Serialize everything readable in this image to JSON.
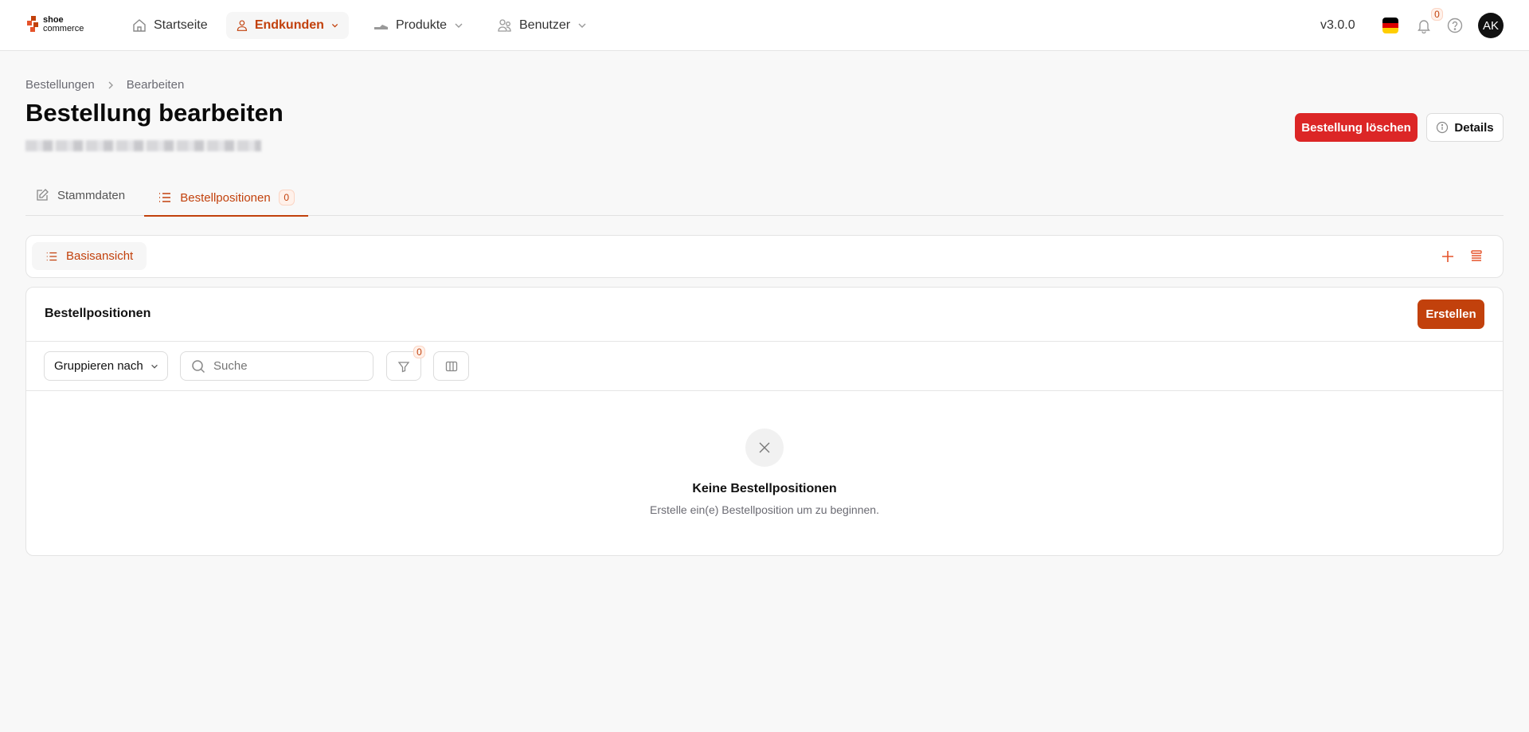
{
  "brand": {
    "line1": "shoe",
    "line2": "commerce",
    "color": "#c2410c"
  },
  "nav": [
    {
      "label": "Startseite",
      "icon": "home-icon"
    },
    {
      "label": "Endkunden",
      "icon": "user-icon",
      "active": true
    },
    {
      "label": "Produkte",
      "icon": "shoe-icon"
    },
    {
      "label": "Benutzer",
      "icon": "users-icon"
    }
  ],
  "header": {
    "version": "v3.0.0",
    "notifications": "0",
    "avatar": "AK",
    "language_flag": "de-flag-icon"
  },
  "breadcrumb": [
    "Bestellungen",
    "Bearbeiten"
  ],
  "page": {
    "title": "Bestellung bearbeiten",
    "delete_label": "Bestellung löschen",
    "details_label": "Details"
  },
  "tabs": [
    {
      "label": "Stammdaten"
    },
    {
      "label": "Bestellpositionen",
      "count": "0",
      "active": true
    }
  ],
  "views": {
    "active": "Basisansicht"
  },
  "list": {
    "title": "Bestellpositionen",
    "create_label": "Erstellen",
    "group_by": "Gruppieren nach",
    "search_placeholder": "Suche",
    "filter_count": "0"
  },
  "empty": {
    "title": "Keine Bestellpositionen",
    "subtitle": "Erstelle ein(e) Bestellposition um zu beginnen."
  },
  "colors": {
    "accent": "#c2410c",
    "danger": "#dc2626"
  }
}
